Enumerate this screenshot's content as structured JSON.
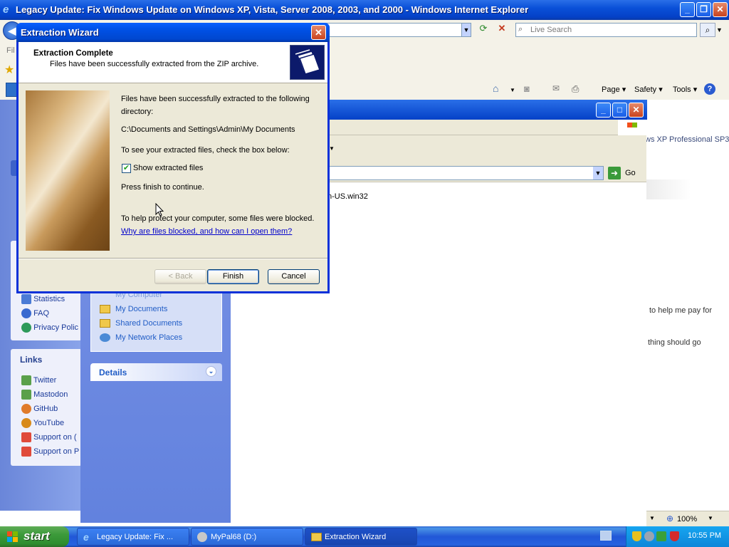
{
  "ie": {
    "title": "Legacy Update: Fix Windows Update on Windows XP, Vista, Server 2008, 2003, and 2000 - Windows Internet Explorer",
    "search_placeholder": "Live Search",
    "menu_stub": "Fil",
    "command_bar": [
      "Page",
      "Safety",
      "Tools"
    ],
    "zoom": "100%"
  },
  "site": {
    "top_right_text": "ws XP Professional SP3",
    "side_links_top": [
      "Statistics",
      "FAQ",
      "Privacy Polic"
    ],
    "links_heading": "Links",
    "links": [
      "Twitter",
      "Mastodon",
      "GitHub",
      "YouTube",
      "Support on (",
      "Support on P"
    ],
    "body_text_1": "to help me pay for",
    "body_text_2": "thing should go"
  },
  "explorer": {
    "file_item": "n-US.win32",
    "go_label": "Go",
    "other_places": [
      "My Computer",
      "My Documents",
      "Shared Documents",
      "My Network Places"
    ],
    "details_heading": "Details"
  },
  "wizard": {
    "title": "Extraction Wizard",
    "header_title": "Extraction Complete",
    "header_subtitle": "Files have been successfully extracted from the ZIP archive.",
    "line1": "Files have been successfully extracted to the following",
    "line2": "directory:",
    "path": "C:\\Documents and Settings\\Admin\\My Documents",
    "checkbox_hint": "To see your extracted files, check the box below:",
    "checkbox_label": "Show extracted files",
    "checkbox_checked": true,
    "finish_hint": "Press finish to continue.",
    "blocked_text": "To help protect your computer, some files were blocked.",
    "blocked_link": "Why are files blocked, and how can I open them?",
    "back_label": "< Back",
    "finish_label": "Finish",
    "cancel_label": "Cancel"
  },
  "taskbar": {
    "start_label": "start",
    "tasks": [
      "Legacy Update: Fix ...",
      "MyPal68 (D:)",
      "Extraction Wizard"
    ],
    "clock": "10:55 PM"
  },
  "colors": {
    "xp_blue": "#0a50d8",
    "start_green": "#3c9a3a",
    "link_blue": "#0000cc"
  }
}
